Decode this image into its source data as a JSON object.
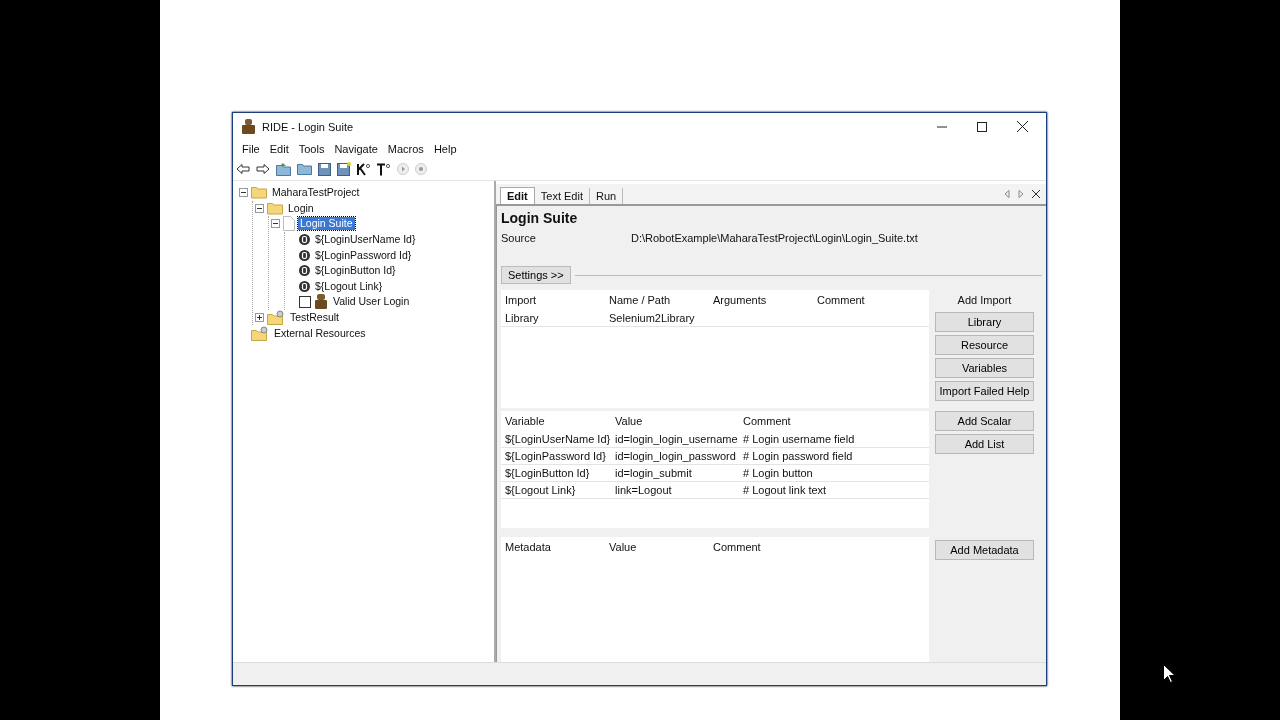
{
  "window": {
    "title": "RIDE - Login Suite"
  },
  "menu": [
    "File",
    "Edit",
    "Tools",
    "Navigate",
    "Macros",
    "Help"
  ],
  "tree": [
    {
      "label": "MaharaTestProject",
      "kind": "folder",
      "expanded": true,
      "selected": false,
      "children": [
        {
          "label": "Login",
          "kind": "folder",
          "expanded": true,
          "selected": false,
          "children": [
            {
              "label": "Login Suite",
              "kind": "suite",
              "expanded": true,
              "selected": true,
              "children": [
                {
                  "label": "${LoginUserName Id}",
                  "kind": "variable",
                  "selected": false
                },
                {
                  "label": "${LoginPassword Id}",
                  "kind": "variable",
                  "selected": false
                },
                {
                  "label": "${LoginButton Id}",
                  "kind": "variable",
                  "selected": false
                },
                {
                  "label": "${Logout Link}",
                  "kind": "variable",
                  "selected": false
                },
                {
                  "label": "Valid User Login",
                  "kind": "test",
                  "checked": false,
                  "selected": false
                }
              ]
            }
          ]
        },
        {
          "label": "TestResult",
          "kind": "resource",
          "expanded": false,
          "selected": false
        }
      ]
    },
    {
      "label": "External Resources",
      "kind": "resource",
      "selected": false
    }
  ],
  "tabs": [
    {
      "label": "Edit",
      "selected": true
    },
    {
      "label": "Text Edit",
      "selected": false
    },
    {
      "label": "Run",
      "selected": false
    }
  ],
  "editor": {
    "title": "Login Suite",
    "source_label": "Source",
    "source_value": "D:\\RobotExample\\MaharaTestProject\\Login\\Login_Suite.txt",
    "settings_button": "Settings >>",
    "imports": {
      "columns": [
        "Import",
        "Name / Path",
        "Arguments",
        "Comment"
      ],
      "rows": [
        [
          "Library",
          "Selenium2Library",
          "",
          ""
        ]
      ],
      "heading": "Add Import",
      "buttons": [
        "Library",
        "Resource",
        "Variables",
        "Import Failed Help"
      ]
    },
    "variables": {
      "columns": [
        "Variable",
        "Value",
        "Comment"
      ],
      "rows": [
        [
          "${LoginUserName Id}",
          "id=login_login_username",
          "# Login username field"
        ],
        [
          "${LoginPassword Id}",
          "id=login_login_password",
          "# Login password field"
        ],
        [
          "${LoginButton Id}",
          "id=login_submit",
          "# Login button"
        ],
        [
          "${Logout Link}",
          "link=Logout",
          "# Logout link text"
        ]
      ],
      "buttons": [
        "Add Scalar",
        "Add List"
      ]
    },
    "metadata": {
      "columns": [
        "Metadata",
        "Value",
        "Comment"
      ],
      "buttons": [
        "Add Metadata"
      ]
    }
  }
}
